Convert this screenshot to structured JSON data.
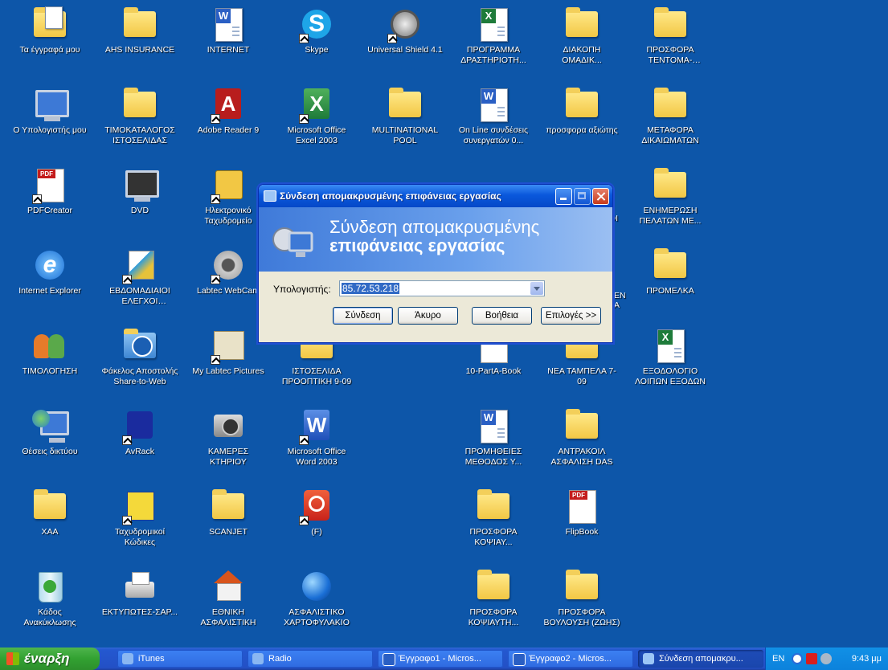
{
  "desktop": {
    "icons": [
      {
        "label": "Τα έγγραφά μου",
        "type": "folder-docs"
      },
      {
        "label": "AHS INSURANCE",
        "type": "folder"
      },
      {
        "label": "INTERNET",
        "type": "word"
      },
      {
        "label": "Skype",
        "type": "skype"
      },
      {
        "label": "Universal Shield 4.1",
        "type": "shield"
      },
      {
        "label": "ΠΡΟΓΡΑΜΜΑ ΔΡΑΣΤΗΡΙΟΤΗ...",
        "type": "excel"
      },
      {
        "label": "ΔΙΑΚΟΠΗ ΟΜΑΔΙΚ...",
        "type": "folder"
      },
      {
        "label": "ΠΡΟΣΦΟΡΑ ΤΕΝΤΟΜΑ-ΝΤΑΝΟΣ",
        "type": "folder"
      },
      {
        "label": "Ο Υπολογιστής μου",
        "type": "computer"
      },
      {
        "label": "ΤΙΜΟΚΑΤΑΛΟΓΟΣ ΙΣΤΟΣΕΛΙΔΑΣ",
        "type": "folder"
      },
      {
        "label": "Adobe Reader 9",
        "type": "acrobat"
      },
      {
        "label": "Microsoft Office Excel 2003",
        "type": "excel-app"
      },
      {
        "label": "MULTINATIONAL POOL",
        "type": "folder"
      },
      {
        "label": "On Line συνδέσεις συνεργατών 0...",
        "type": "word"
      },
      {
        "label": "προσφορα αξιώτης",
        "type": "folder"
      },
      {
        "label": "ΜΕΤΑΦΟΡΑ ΔΙΚΑΙΩΜΑΤΩΝ",
        "type": "folder"
      },
      {
        "label": "PDFCreator",
        "type": "pdfcreator"
      },
      {
        "label": "DVD",
        "type": "dvd"
      },
      {
        "label": "Ηλεκτρονικό Ταχυδρομείο",
        "type": "mail"
      },
      {
        "label": "ΕΝΗΜΕΡΩΣΗ ΠΕΛΑΤΩΝ ΜΕ...",
        "type": "folder"
      },
      {
        "label": "Internet Explorer",
        "type": "ie"
      },
      {
        "label": "ΕΒΔΟΜΑΔΙΑΙΟΙ ΕΛΕΓΧΟΙ ΓΡΑΦΕΙΟΥ",
        "type": "paint"
      },
      {
        "label": "Labtec WebCam",
        "type": "webcam"
      },
      {
        "label": "ΠΡΟΜΕΛΚΑ",
        "type": "folder"
      },
      {
        "label": "ΤΙΜΟΛΟΓΗΣΗ",
        "type": "users"
      },
      {
        "label": "Φάκελος Αποστολής Share-to-Web",
        "type": "hpfolder"
      },
      {
        "label": "My Labtec Pictures",
        "type": "pictures"
      },
      {
        "label": "ΙΣΤΟΣΕΛΙΔΑ ΠΡΟΟΠΤΙΚΗ 9-09",
        "type": "folder"
      },
      {
        "label": "10-PartA-Book",
        "type": "pdf"
      },
      {
        "label": "ΝΕΑ ΤΑΜΠΕΛΑ 7-09",
        "type": "folder"
      },
      {
        "label": "ΕΞΟΔΟΛΟΓΙΟ ΛΟΙΠΩΝ ΕΞΟΔΩΝ",
        "type": "excel"
      },
      {
        "label": "Θέσεις δικτύου",
        "type": "network"
      },
      {
        "label": "AvRack",
        "type": "avrack"
      },
      {
        "label": "ΚΑΜΕΡΕΣ ΚΤΗΡΙΟΥ",
        "type": "camera"
      },
      {
        "label": "Microsoft Office Word 2003",
        "type": "word-app"
      },
      {
        "label": "ΠΡΟΜΗΘΕΙΕΣ ΜΕΘΟΔΟΣ Υ...",
        "type": "word"
      },
      {
        "label": "ΑΝΤΡΑΚΟΙΛ ΑΣΦΑΛΙΣΗ DAS",
        "type": "folder"
      },
      {
        "label": "ΧΑΑ",
        "type": "folder"
      },
      {
        "label": "Ταχυδρομικοί Κώδικες",
        "type": "elta"
      },
      {
        "label": "SCANJET",
        "type": "folder"
      },
      {
        "label": "(F)",
        "type": "power"
      },
      {
        "label": "ΠΡΟΣΦΟΡΑ ΚΟΨΙΑΥ...",
        "type": "folder"
      },
      {
        "label": "FlipBook",
        "type": "pdf"
      },
      {
        "label": "Κάδος Ανακύκλωσης",
        "type": "recycle"
      },
      {
        "label": "ΕΚΤΥΠΩΤΕΣ-ΣΑΡ...",
        "type": "printer"
      },
      {
        "label": "ΕΘΝΙΚΗ ΑΣΦΑΛΙΣΤΙΚΗ",
        "type": "house"
      },
      {
        "label": "ΑΣΦΑΛΙΣΤΙΚΟ ΧΑΡΤΟΦΥΛΑΚΙΟ",
        "type": "globe"
      },
      {
        "label": "ΠΡΟΣΦΟΡΑ ΚΟΨΙΑΥΤΗ...",
        "type": "folder"
      },
      {
        "label": "ΠΡΟΣΦΟΡΑ ΒΟΥΛΟΥΣΗ (ΖΩΗΣ)",
        "type": "folder"
      }
    ],
    "partial_labels": [
      "ΟΙ",
      "ΕΝ",
      "Α"
    ]
  },
  "dialog": {
    "title": "Σύνδεση απομακρυσμένης επιφάνειας εργασίας",
    "banner_line1": "Σύνδεση απομακρυσμένης",
    "banner_line2": "επιφάνειας εργασίας",
    "computer_label": "Υπολογιστής:",
    "computer_value": "85.72.53.218",
    "buttons": {
      "connect": "Σύνδεση",
      "cancel": "Άκυρο",
      "help": "Βοήθεια",
      "options": "Επιλογές >>"
    }
  },
  "taskbar": {
    "start_label": "έναρξη",
    "items": [
      {
        "label": "iTunes",
        "active": false
      },
      {
        "label": "Radio",
        "active": false
      },
      {
        "label": "Έγγραφο1 - Micros...",
        "active": false
      },
      {
        "label": "Έγγραφο2 - Micros...",
        "active": false
      },
      {
        "label": "Σύνδεση απομακρυ...",
        "active": true
      }
    ],
    "tray": {
      "language": "EN",
      "clock": "9:43 μμ"
    }
  },
  "colors": {
    "desktop": "#0d56a9",
    "title_bar": "#0a58dc",
    "start_button": "#32a131",
    "tray": "#0c82dc"
  }
}
